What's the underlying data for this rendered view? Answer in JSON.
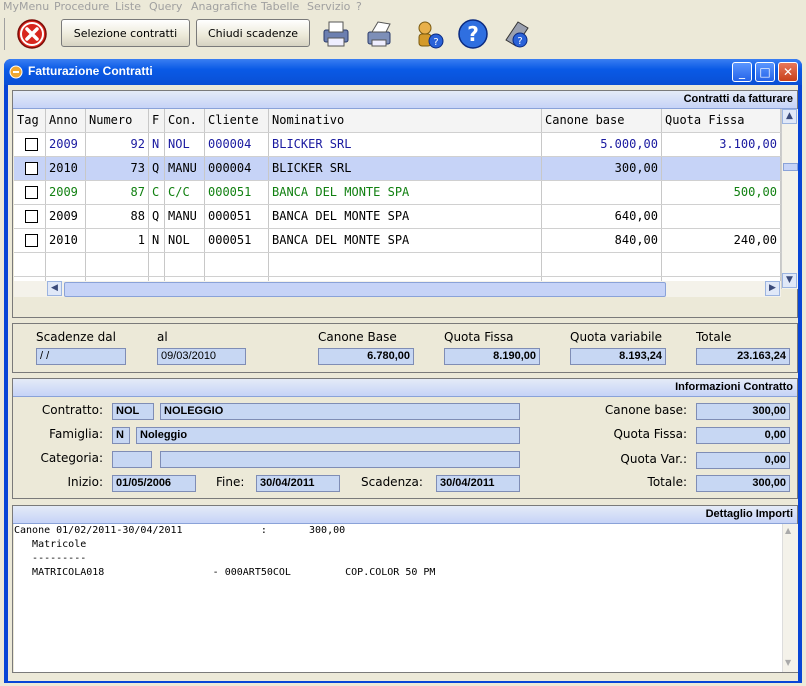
{
  "menu": [
    "MyMenu",
    "Procedure",
    "Liste",
    "Query",
    "Anagrafiche",
    "Tabelle",
    "Servizio",
    "?"
  ],
  "toolbar": {
    "select_contracts": "Selezione contratti",
    "close_deadlines": "Chiudi scadenze"
  },
  "window": {
    "title": "Fatturazione Contratti"
  },
  "contracts": {
    "header": "Contratti da fatturare",
    "columns": [
      "Tag",
      "Anno",
      "Numero",
      "F",
      "Con.",
      "Cliente",
      "Nominativo",
      "Canone base",
      "Quota Fissa"
    ],
    "rows": [
      {
        "anno": "2009",
        "numero": "92",
        "f": "N",
        "con": "NOL",
        "cliente": "000004",
        "nominativo": "BLICKER SRL",
        "canone": "5.000,00",
        "quota": "3.100,00",
        "color": "#1a1aa0"
      },
      {
        "anno": "2010",
        "numero": "73",
        "f": "Q",
        "con": "MANU",
        "cliente": "000004",
        "nominativo": "BLICKER SRL",
        "canone": "300,00",
        "quota": "",
        "color": "#000000"
      },
      {
        "anno": "2009",
        "numero": "87",
        "f": "C",
        "con": "C/C",
        "cliente": "000051",
        "nominativo": "BANCA DEL MONTE SPA",
        "canone": "",
        "quota": "500,00",
        "color": "#118011"
      },
      {
        "anno": "2009",
        "numero": "88",
        "f": "Q",
        "con": "MANU",
        "cliente": "000051",
        "nominativo": "BANCA DEL MONTE SPA",
        "canone": "640,00",
        "quota": "",
        "color": "#000000"
      },
      {
        "anno": "2010",
        "numero": "1",
        "f": "N",
        "con": "NOL",
        "cliente": "000051",
        "nominativo": "BANCA DEL MONTE SPA",
        "canone": "840,00",
        "quota": "240,00",
        "color": "#000000"
      }
    ]
  },
  "summary": {
    "scadenze_dal_label": "Scadenze dal",
    "scadenze_dal": " / /",
    "al_label": "al",
    "al": "09/03/2010",
    "canone_base_label": "Canone Base",
    "canone_base": "6.780,00",
    "quota_fissa_label": "Quota Fissa",
    "quota_fissa": "8.190,00",
    "quota_variabile_label": "Quota variabile",
    "quota_variabile": "8.193,24",
    "totale_label": "Totale",
    "totale": "23.163,24"
  },
  "info": {
    "header": "Informazioni Contratto",
    "contratto_label": "Contratto:",
    "contratto_code": "NOL",
    "contratto_desc": "NOLEGGIO",
    "famiglia_label": "Famiglia:",
    "famiglia_code": "N",
    "famiglia_desc": "Noleggio",
    "categoria_label": "Categoria:",
    "categoria_code": "",
    "categoria_desc": "",
    "inizio_label": "Inizio:",
    "inizio": "01/05/2006",
    "fine_label": "Fine:",
    "fine": "30/04/2011",
    "scadenza_label": "Scadenza:",
    "scadenza": "30/04/2011",
    "canone_base_label": "Canone base:",
    "canone_base": "300,00",
    "quota_fissa_label": "Quota Fissa:",
    "quota_fissa": "0,00",
    "quota_var_label": "Quota Var.:",
    "quota_var": "0,00",
    "totale_label": "Totale:",
    "totale": "300,00"
  },
  "detail": {
    "header": "Dettaglio Importi",
    "text": "Canone 01/02/2011-30/04/2011             :       300,00\n   Matricole\n   ---------\n   MATRICOLA018                  - 000ART50COL         COP.COLOR 50 PM"
  }
}
